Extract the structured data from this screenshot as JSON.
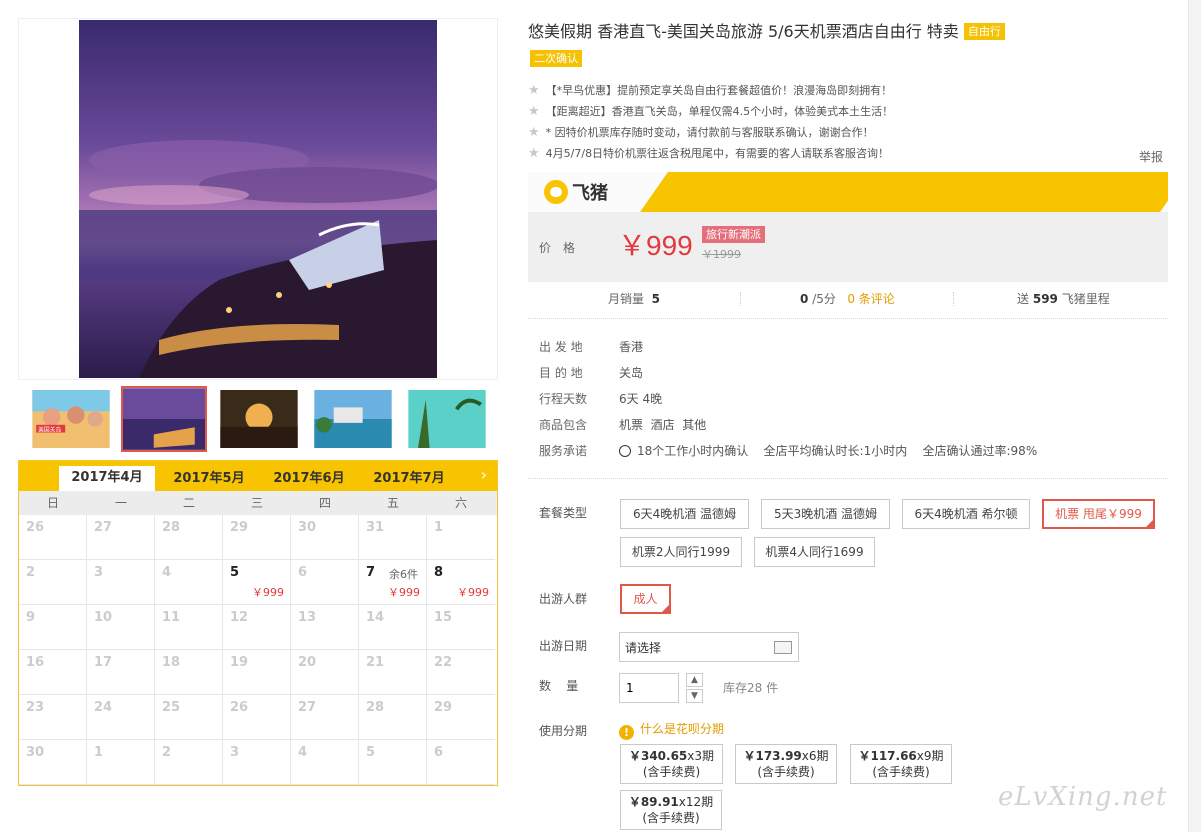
{
  "title": "悠美假期 香港直飞-美国关岛旅游 5/6天机票酒店自由行 特卖",
  "title_tag": "自由行",
  "badge_confirm": "二次确认",
  "promos": [
    "【*早鸟优惠】提前预定享关岛自由行套餐超值价！浪漫海岛即刻拥有！",
    "【距离超近】香港直飞关岛，单程仅需4.5个小时，体验美式本土生活！",
    "* 因特价机票库存随时变动，请付款前与客服联系确认，谢谢合作！",
    "4月5/7/8日特价机票往返含税甩尾中，有需要的客人请联系客服咨询！"
  ],
  "report": "举报",
  "brand": "飞猪",
  "price": {
    "label": "价格",
    "now": "￥999",
    "tag": "旅行新潮派",
    "old": "￥1999"
  },
  "stats": {
    "monthly_sales_label": "月销量",
    "monthly_sales": "5",
    "rating": "0",
    "rating_suffix": "/5分",
    "reviews": "0 条评论",
    "mileage_prefix": "送",
    "mileage": "599",
    "mileage_suffix": "飞猪里程"
  },
  "info": {
    "depart_label": "出 发 地",
    "depart": "香港",
    "dest_label": "目 的 地",
    "dest": "关岛",
    "days_label": "行程天数",
    "days": "6天 4晚",
    "includes_label": "商品包含",
    "includes": "机票  酒店  其他",
    "service_label": "服务承诺",
    "service_1": "18个工作小时内确认",
    "service_2": "全店平均确认时长:1小时内",
    "service_3": "全店确认通过率:98%"
  },
  "package": {
    "label": "套餐类型",
    "options": [
      "6天4晚机酒 温德姆",
      "5天3晚机酒 温德姆",
      "6天4晚机酒 希尔顿",
      "机票 甩尾￥999",
      "机票2人同行1999",
      "机票4人同行1699"
    ],
    "selected": "机票 甩尾￥999"
  },
  "traveler": {
    "label": "出游人群",
    "option": "成人"
  },
  "travel_date": {
    "label": "出游日期",
    "value": "请选择"
  },
  "quantity": {
    "label": "数    量",
    "value": "1",
    "stock": "库存28 件"
  },
  "installment": {
    "label": "使用分期",
    "link": "什么是花呗分期",
    "plans": [
      {
        "amount": "￥340.65",
        "period": "x3期",
        "note": "(含手续费)"
      },
      {
        "amount": "￥173.99",
        "period": "x6期",
        "note": "(含手续费)"
      },
      {
        "amount": "￥117.66",
        "period": "x9期",
        "note": "(含手续费)"
      },
      {
        "amount": "￥89.91",
        "period": "x12期",
        "note": "(含手续费)"
      }
    ]
  },
  "calendar": {
    "tabs": [
      "2017年4月",
      "2017年5月",
      "2017年6月",
      "2017年7月"
    ],
    "next": "›",
    "weekdays": [
      "日",
      "一",
      "二",
      "三",
      "四",
      "五",
      "六"
    ],
    "days": [
      {
        "d": "26"
      },
      {
        "d": "27"
      },
      {
        "d": "28"
      },
      {
        "d": "29"
      },
      {
        "d": "30"
      },
      {
        "d": "31"
      },
      {
        "d": "1"
      },
      {
        "d": "2"
      },
      {
        "d": "3"
      },
      {
        "d": "4"
      },
      {
        "d": "5",
        "price": "￥999"
      },
      {
        "d": "6"
      },
      {
        "d": "7",
        "stock": "余6件",
        "price": "￥999"
      },
      {
        "d": "8",
        "price": "￥999"
      },
      {
        "d": "9"
      },
      {
        "d": "10"
      },
      {
        "d": "11"
      },
      {
        "d": "12"
      },
      {
        "d": "13"
      },
      {
        "d": "14"
      },
      {
        "d": "15"
      },
      {
        "d": "16"
      },
      {
        "d": "17"
      },
      {
        "d": "18"
      },
      {
        "d": "19"
      },
      {
        "d": "20"
      },
      {
        "d": "21"
      },
      {
        "d": "22"
      },
      {
        "d": "23"
      },
      {
        "d": "24"
      },
      {
        "d": "25"
      },
      {
        "d": "26"
      },
      {
        "d": "27"
      },
      {
        "d": "28"
      },
      {
        "d": "29"
      },
      {
        "d": "30"
      },
      {
        "d": "1"
      },
      {
        "d": "2"
      },
      {
        "d": "3"
      },
      {
        "d": "4"
      },
      {
        "d": "5"
      },
      {
        "d": "6"
      }
    ]
  },
  "thumb_labels": [
    "美国关岛"
  ],
  "watermark": "eLvXing.net",
  "colors": {
    "accent_yellow": "#f8c400",
    "price_red": "#e4393c",
    "select_red": "#e0584a",
    "link_orange": "#e39c00"
  }
}
